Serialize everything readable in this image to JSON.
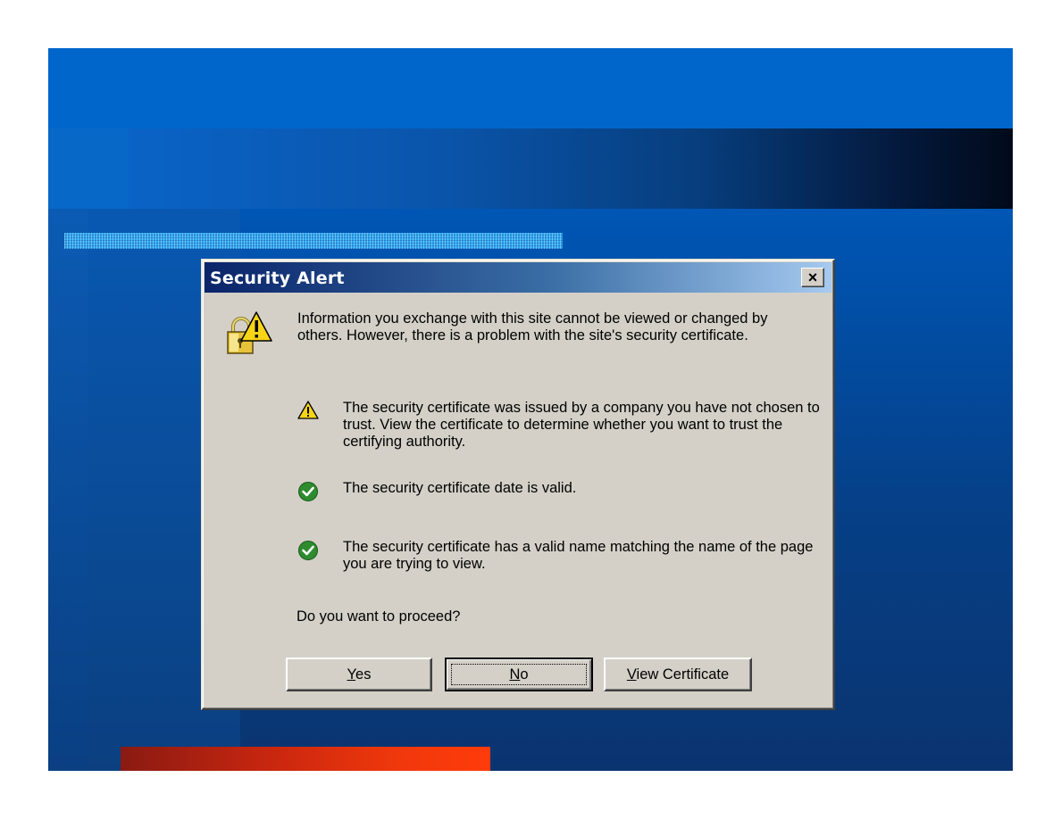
{
  "dialog": {
    "title": "Security Alert",
    "close_label": "×",
    "intro": "Information you exchange with this site cannot be viewed or changed by others. However, there is a problem with the site's security certificate.",
    "items": [
      {
        "icon": "warning-icon",
        "text": "The security certificate was issued by a company you have not chosen to trust. View the certificate to determine whether you want to trust the certifying authority."
      },
      {
        "icon": "check-icon",
        "text": "The security certificate date is valid."
      },
      {
        "icon": "check-icon",
        "text": "The security certificate has a valid name matching the name of the page you are trying to view."
      }
    ],
    "question": "Do you want to proceed?",
    "buttons": {
      "yes": {
        "mnemonic": "Y",
        "rest": "es"
      },
      "no": {
        "mnemonic": "N",
        "rest": "o"
      },
      "view": {
        "mnemonic": "V",
        "rest": "iew Certificate"
      }
    }
  },
  "colors": {
    "dialog_face": "#d4d0c8",
    "titlebar_start": "#0a246a",
    "titlebar_end": "#a6caf0",
    "warning": "#f7d417",
    "check": "#2e8b2e",
    "slide_accent_red": "#f0380c"
  }
}
